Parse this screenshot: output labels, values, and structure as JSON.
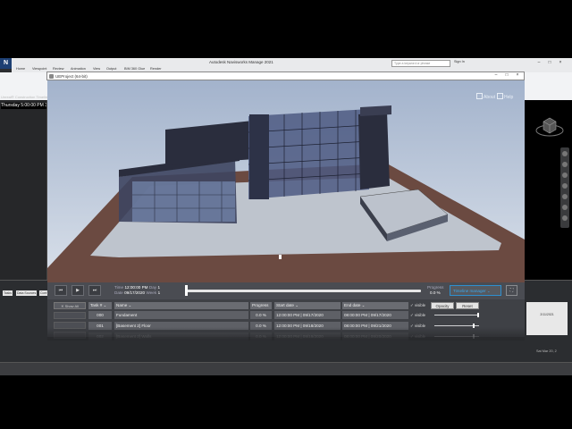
{
  "host": {
    "title": "Autodesk Navisworks Manage 2021",
    "logo": "N",
    "search_placeholder": "Type a keyword or phrase",
    "signin": "Sign In",
    "ribbon_tabs": [
      "Home",
      "Viewpoint",
      "Review",
      "Animation",
      "View",
      "Output",
      "BIM 360 Glue",
      "Render"
    ],
    "left_panel_title": "Unreal® Construction Timeline",
    "left_time": "Thursday 5:00:00 PM 3/...",
    "bottom_tabs": [
      "Tasks",
      "Data Sources",
      "Conf"
    ],
    "right_cal_date": "2/11/2021",
    "right_cal_footer": "Sat Mar 20, 2"
  },
  "ue": {
    "title": "UEProject (64-bit)",
    "about": "About",
    "help": "Help"
  },
  "timeline": {
    "time_label": "Time",
    "time_value": "12:00:00 PM",
    "day_label": "Day",
    "day_value": "1",
    "date_label": "Date",
    "date_value": "09/17/2020",
    "week_label": "Week",
    "week_value": "1",
    "progress_label": "Progress",
    "progress_value": "0.0 %",
    "progress_fraction": 0.0,
    "timeline_manager": "Timeline manager",
    "skip_back_icon": "⏮",
    "play_icon": "▶",
    "skip_forward_icon": "⏭"
  },
  "tasks": {
    "show_all": "Show All",
    "headers": {
      "task": "Task #",
      "name": "Name",
      "progress": "Progress",
      "start": "Start date",
      "end": "End date",
      "visible": "visible",
      "opacity": "Opacity",
      "reset": "Reset"
    },
    "rows": [
      {
        "task": "000",
        "name": "Fundament",
        "progress": "0.0 %",
        "start": "12:00:00 PM | 09/17/2020",
        "end": "08:00:00 PM | 09/17/2020",
        "visible": "visible",
        "opacity": 1.0
      },
      {
        "task": "001",
        "name": "[Basement 2] Floor",
        "progress": "0.0 %",
        "start": "12:00:00 PM | 09/18/2020",
        "end": "08:00:00 PM | 09/21/2020",
        "visible": "visible",
        "opacity": 0.9
      },
      {
        "task": "002",
        "name": "[Basement 2] Walls",
        "progress": "0.0 %",
        "start": "12:00:00 PM | 09/19/2020",
        "end": "08:00:00 PM | 09/20/2020",
        "visible": "visible",
        "opacity": 0.9
      }
    ]
  },
  "colors": {
    "sky_top": "#a3b3cc",
    "sky_bottom": "#d9e0ea",
    "ground": "#6b4a41",
    "pad": "#bec4cd",
    "building_dark": "#2a2d3d",
    "accent_blue": "#2e8fcf"
  }
}
